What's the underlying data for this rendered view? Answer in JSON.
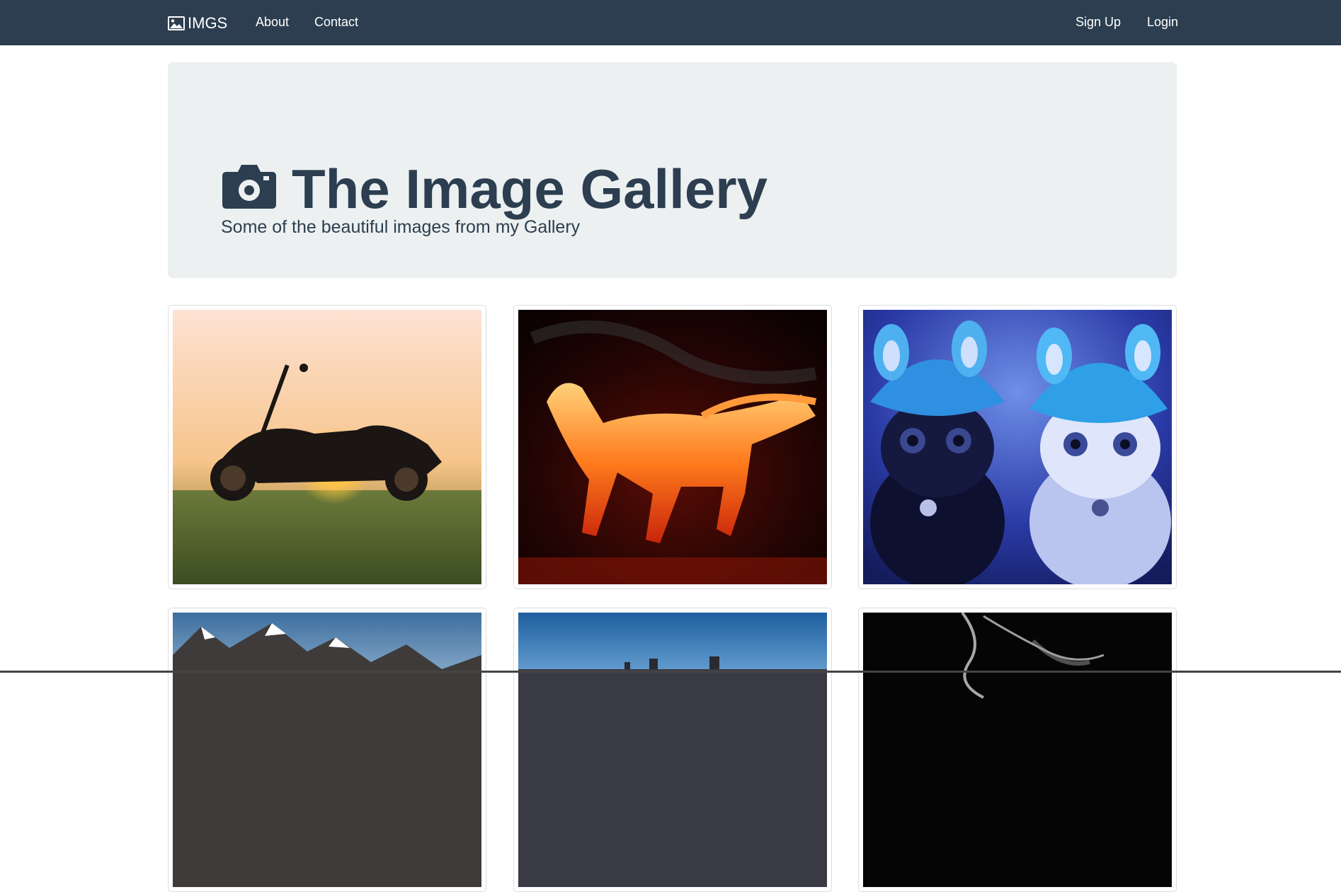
{
  "navbar": {
    "brand_label": "IMGS",
    "brand_icon": "picture-icon",
    "links": {
      "about": "About",
      "contact": "Contact",
      "signup": "Sign Up",
      "login": "Login"
    },
    "background": "#2c3e50"
  },
  "jumbotron": {
    "icon": "camera-icon",
    "title": "The Image Gallery",
    "subtitle": "Some of the beautiful images from my Gallery",
    "background": "#ecf0f1",
    "text_color": "#2c3e50"
  },
  "gallery": {
    "images": [
      {
        "subject": "motorcycle at sunset"
      },
      {
        "subject": "fire horse"
      },
      {
        "subject": "kittens in blue hats"
      },
      {
        "subject": "snowy mountains"
      },
      {
        "subject": "city skyline"
      },
      {
        "subject": "smoke on black"
      }
    ]
  }
}
